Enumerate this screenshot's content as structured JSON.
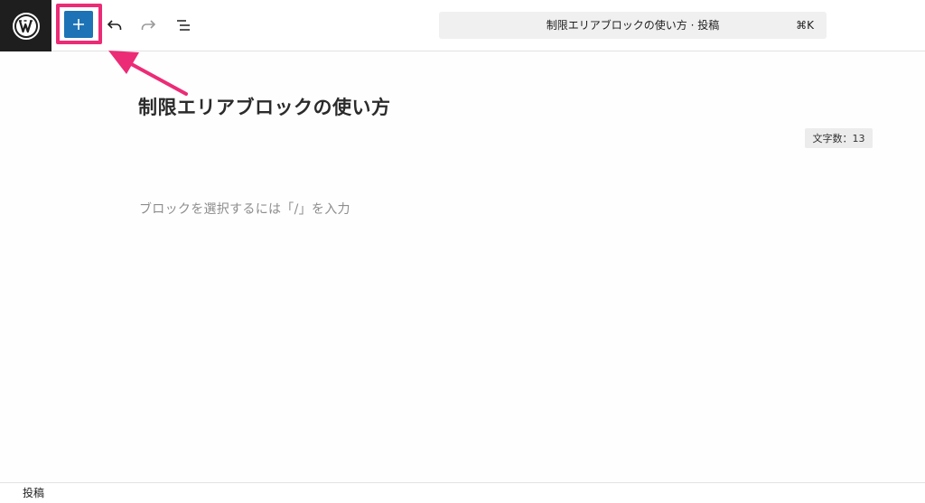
{
  "toolbar": {
    "logo_icon": "wordpress-logo-icon",
    "add_block_icon": "plus-icon",
    "undo_icon": "undo-icon",
    "redo_icon": "redo-icon",
    "outline_icon": "document-outline-icon",
    "command_bar": {
      "title": "制限エリアブロックの使い方 · 投稿",
      "shortcut": "⌘K"
    },
    "accent_color": "#1d73b6"
  },
  "annotation": {
    "highlight_color": "#ec2b76"
  },
  "editor": {
    "post_title": "制限エリアブロックの使い方",
    "word_count": "文字数：13",
    "block_placeholder": "ブロックを選択するには「/」を入力"
  },
  "footer": {
    "breadcrumb": "投稿"
  }
}
